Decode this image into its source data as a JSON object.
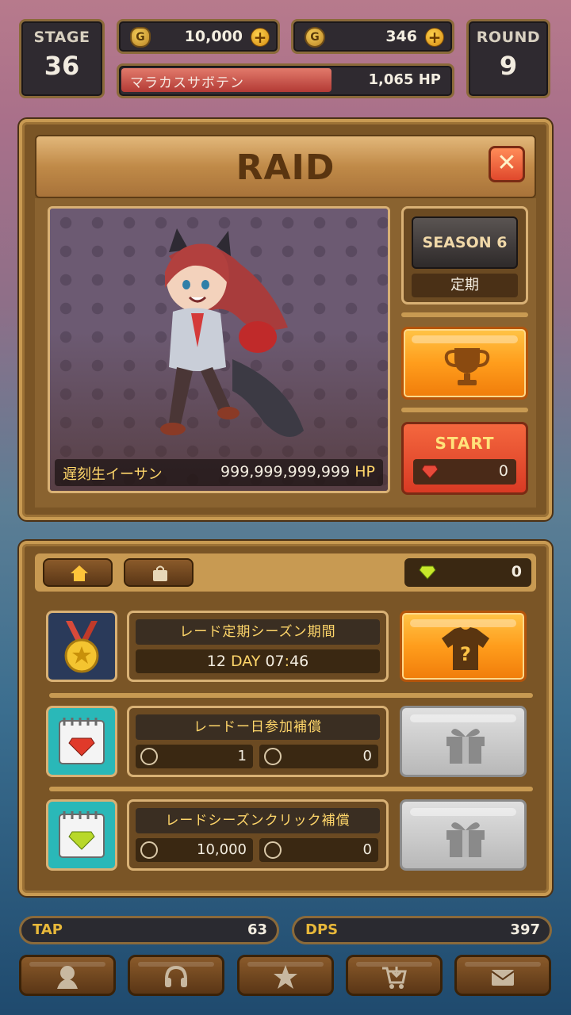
{
  "hud": {
    "stage_label": "STAGE",
    "stage_value": "36",
    "gold": "10,000",
    "gems": "346",
    "round_label": "ROUND",
    "round_value": "9",
    "enemy_name": "マラカスサボテン",
    "enemy_hp": "1,065 HP",
    "enemy_hp_fraction": 0.63
  },
  "raid": {
    "title": "RAID",
    "boss_name": "遅刻生イーサン",
    "boss_hp_value": "999,999,999,999",
    "boss_hp_unit": "HP",
    "season_label": "SEASON 6",
    "season_type": "定期",
    "start_label": "START",
    "start_cost": "0"
  },
  "lower": {
    "gem_count": "0",
    "rows": [
      {
        "title": "レード定期シーズン期間",
        "days": "12",
        "day_label": "DAY",
        "hours": "07",
        "minutes": "46"
      },
      {
        "title": "レードー日参加補償",
        "target_value": "1",
        "play_value": "0"
      },
      {
        "title": "レードシーズンクリック補償",
        "target_value": "10,000",
        "play_value": "0"
      }
    ]
  },
  "stats": {
    "tap_label": "TAP",
    "tap_value": "63",
    "dps_label": "DPS",
    "dps_value": "397"
  },
  "nav": [
    "hero-icon",
    "headphones-icon",
    "star-icon",
    "cart-icon",
    "mail-icon"
  ],
  "colors": {
    "accent_orange": "#ff9d1c",
    "gold_text": "#ffd66a",
    "start_red": "#d93a24",
    "panel_brown": "#7a5526"
  }
}
